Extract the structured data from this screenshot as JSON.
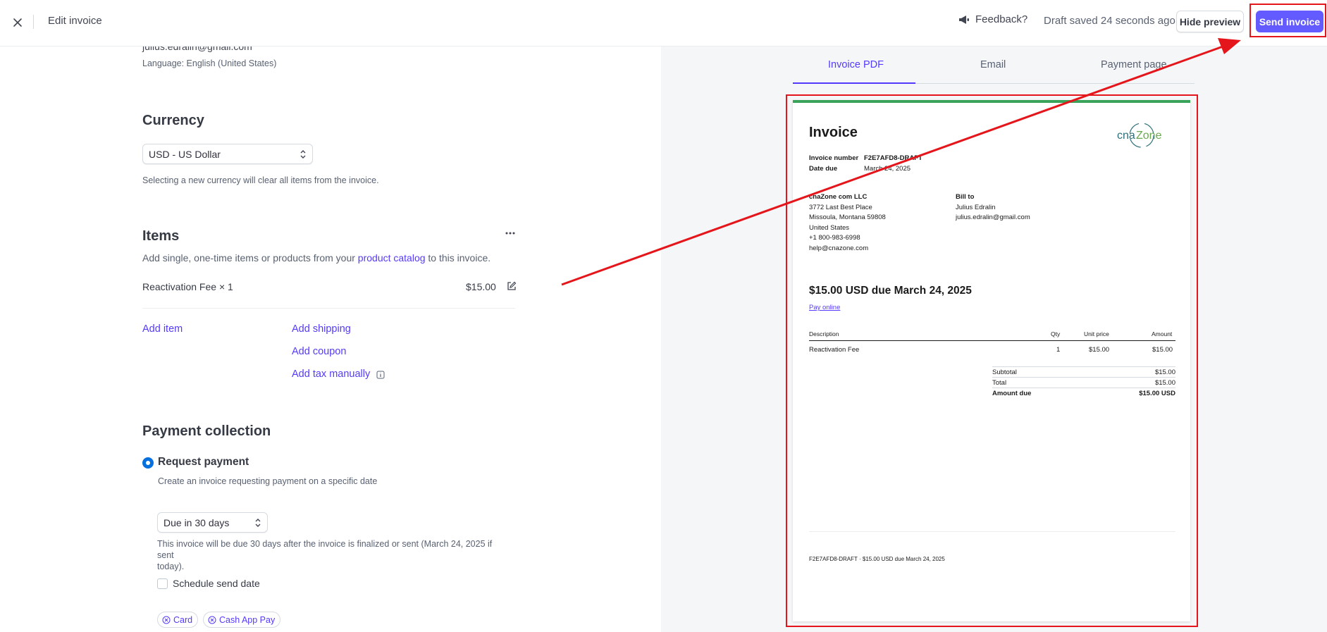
{
  "header": {
    "title": "Edit invoice",
    "feedback_label": "Feedback?",
    "draft_status": "Draft saved 24 seconds ago",
    "hide_preview_label": "Hide preview",
    "send_invoice_label": "Send invoice"
  },
  "customer": {
    "email": "julius.edralin@gmail.com",
    "language": "Language: English (United States)"
  },
  "currency": {
    "title": "Currency",
    "selected": "USD - US Dollar",
    "hint": "Selecting a new currency will clear all items from the invoice."
  },
  "items": {
    "title": "Items",
    "desc_prefix": "Add single, one-time items or products from your ",
    "desc_link": "product catalog",
    "desc_suffix": " to this invoice.",
    "rows": [
      {
        "name": "Reactivation Fee × 1",
        "price": "$15.00"
      }
    ],
    "add_item": "Add item",
    "add_shipping": "Add shipping",
    "add_coupon": "Add coupon",
    "add_tax": "Add tax manually"
  },
  "payment_collection": {
    "title": "Payment collection",
    "option_label": "Request payment",
    "option_desc": "Create an invoice requesting payment on a specific date",
    "due_selected": "Due in 30 days",
    "due_hint_line1": "This invoice will be due 30 days after the invoice is finalized or sent (March 24, 2025 if sent",
    "due_hint_line2": "today).",
    "schedule_label": "Schedule send date",
    "methods": [
      "Card",
      "Cash App Pay"
    ]
  },
  "preview": {
    "tabs": [
      "Invoice PDF",
      "Email",
      "Payment page"
    ],
    "active_tab": 0,
    "invoice": {
      "heading": "Invoice",
      "logo_text": "cnaZone",
      "invoice_number_label": "Invoice number",
      "invoice_number": "F2E7AFD8-DRAFT",
      "date_due_label": "Date due",
      "date_due": "March 24, 2025",
      "from": {
        "name": "cnaZone com LLC",
        "line1": "3772 Last Best Place",
        "line2": "Missoula, Montana 59808",
        "line3": "United States",
        "phone": "+1 800-983-6998",
        "email": "help@cnazone.com"
      },
      "bill_to": {
        "label": "Bill to",
        "name": "Julius Edralin",
        "email": "julius.edralin@gmail.com"
      },
      "headline": "$15.00 USD due March 24, 2025",
      "pay_online": "Pay online",
      "columns": [
        "Description",
        "Qty",
        "Unit price",
        "Amount"
      ],
      "lines": [
        {
          "description": "Reactivation Fee",
          "qty": "1",
          "unit_price": "$15.00",
          "amount": "$15.00"
        }
      ],
      "subtotal_label": "Subtotal",
      "subtotal": "$15.00",
      "total_label": "Total",
      "total": "$15.00",
      "amount_due_label": "Amount due",
      "amount_due": "$15.00 USD",
      "footer": "F2E7AFD8-DRAFT · $15.00 USD due March 24, 2025"
    }
  },
  "colors": {
    "accent": "#533afd",
    "send_button": "#635bff",
    "annotation_red": "#e5161b",
    "doc_top_bar": "#3aa35a"
  }
}
